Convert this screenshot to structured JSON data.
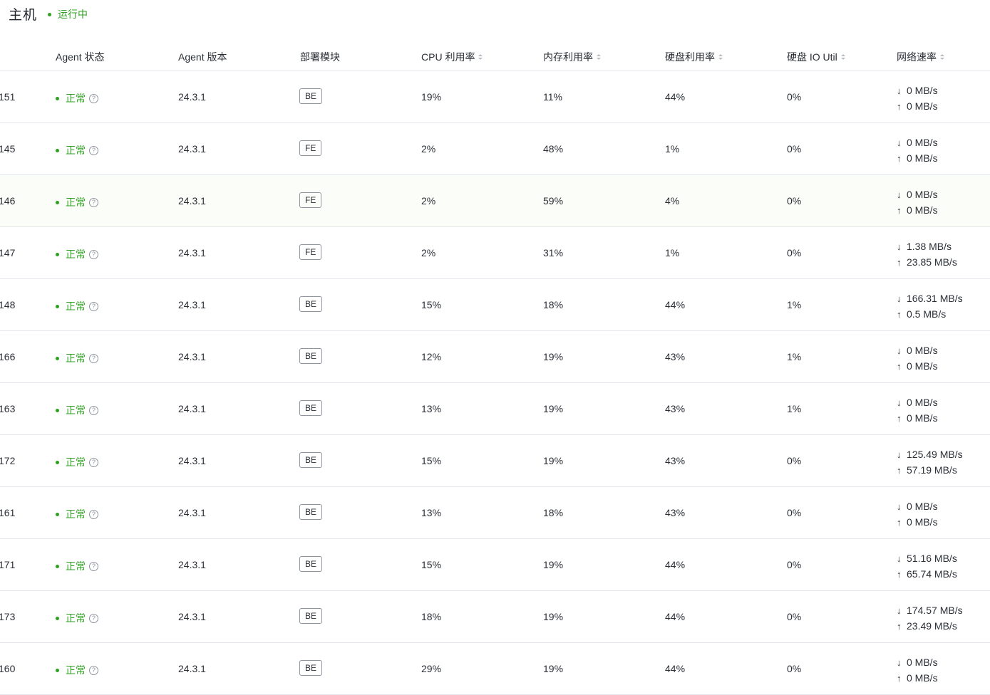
{
  "header": {
    "title": "主机",
    "status": "运行中"
  },
  "columns": {
    "agent_status": "Agent 状态",
    "agent_version": "Agent 版本",
    "module": "部署模块",
    "cpu": "CPU 利用率",
    "mem": "内存利用率",
    "disk": "硬盘利用率",
    "io": "硬盘 IO Util",
    "net": "网络速率"
  },
  "rows": [
    {
      "host": "151",
      "status": "正常",
      "version": "24.3.1",
      "module": "BE",
      "cpu": "19%",
      "mem": "11%",
      "disk": "44%",
      "io": "0%",
      "down": "0 MB/s",
      "up": "0 MB/s"
    },
    {
      "host": "145",
      "status": "正常",
      "version": "24.3.1",
      "module": "FE",
      "cpu": "2%",
      "mem": "48%",
      "disk": "1%",
      "io": "0%",
      "down": "0 MB/s",
      "up": "0 MB/s"
    },
    {
      "host": "146",
      "status": "正常",
      "version": "24.3.1",
      "module": "FE",
      "cpu": "2%",
      "mem": "59%",
      "disk": "4%",
      "io": "0%",
      "down": "0 MB/s",
      "up": "0 MB/s"
    },
    {
      "host": "147",
      "status": "正常",
      "version": "24.3.1",
      "module": "FE",
      "cpu": "2%",
      "mem": "31%",
      "disk": "1%",
      "io": "0%",
      "down": "1.38 MB/s",
      "up": "23.85 MB/s"
    },
    {
      "host": "148",
      "status": "正常",
      "version": "24.3.1",
      "module": "BE",
      "cpu": "15%",
      "mem": "18%",
      "disk": "44%",
      "io": "1%",
      "down": "166.31 MB/s",
      "up": "0.5 MB/s"
    },
    {
      "host": "166",
      "status": "正常",
      "version": "24.3.1",
      "module": "BE",
      "cpu": "12%",
      "mem": "19%",
      "disk": "43%",
      "io": "1%",
      "down": "0 MB/s",
      "up": "0 MB/s"
    },
    {
      "host": "163",
      "status": "正常",
      "version": "24.3.1",
      "module": "BE",
      "cpu": "13%",
      "mem": "19%",
      "disk": "43%",
      "io": "1%",
      "down": "0 MB/s",
      "up": "0 MB/s"
    },
    {
      "host": "172",
      "status": "正常",
      "version": "24.3.1",
      "module": "BE",
      "cpu": "15%",
      "mem": "19%",
      "disk": "43%",
      "io": "0%",
      "down": "125.49 MB/s",
      "up": "57.19 MB/s"
    },
    {
      "host": "161",
      "status": "正常",
      "version": "24.3.1",
      "module": "BE",
      "cpu": "13%",
      "mem": "18%",
      "disk": "43%",
      "io": "0%",
      "down": "0 MB/s",
      "up": "0 MB/s"
    },
    {
      "host": "171",
      "status": "正常",
      "version": "24.3.1",
      "module": "BE",
      "cpu": "15%",
      "mem": "19%",
      "disk": "44%",
      "io": "0%",
      "down": "51.16 MB/s",
      "up": "65.74 MB/s"
    },
    {
      "host": "173",
      "status": "正常",
      "version": "24.3.1",
      "module": "BE",
      "cpu": "18%",
      "mem": "19%",
      "disk": "44%",
      "io": "0%",
      "down": "174.57 MB/s",
      "up": "23.49 MB/s"
    },
    {
      "host": "160",
      "status": "正常",
      "version": "24.3.1",
      "module": "BE",
      "cpu": "29%",
      "mem": "19%",
      "disk": "44%",
      "io": "0%",
      "down": "0 MB/s",
      "up": "0 MB/s"
    }
  ],
  "colors": {
    "status_green": "#2ea121",
    "border": "#e4e7eb",
    "text": "#2b2f36"
  },
  "icons": {
    "help": "question-circle-icon",
    "sort": "sort-icon",
    "down": "arrow-down-icon",
    "up": "arrow-up-icon"
  }
}
